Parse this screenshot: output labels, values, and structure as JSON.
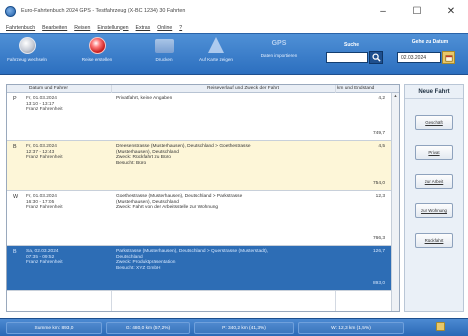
{
  "window": {
    "title": "Euro-Fahrtenbuch 2024 GPS - Testfahrzeug (X-BC 1234) 30 Fahrten",
    "controls": {
      "minimize": "–",
      "maximize": "☐",
      "close": "✕"
    }
  },
  "menu": [
    "Fahrtenbuch",
    "Bearbeiten",
    "Reisen",
    "Einstellungen",
    "Extras",
    "Online",
    "?"
  ],
  "toolbar": {
    "buttons": [
      {
        "label": "Fahrzeug wechseln",
        "icon": "car-icon"
      },
      {
        "label": "Reise erstellen",
        "icon": "stop-icon"
      },
      {
        "label": "Drucken",
        "icon": "print-icon"
      },
      {
        "label": "Auf Karte zeigen",
        "icon": "navigate-icon"
      },
      {
        "label": "Daten importieren",
        "icon": "gps-icon",
        "icon_text": "GPS"
      }
    ],
    "search": {
      "label": "Suche",
      "value": ""
    },
    "goto": {
      "label": "Gehe zu Datum",
      "value": "02.03.2024"
    }
  },
  "grid": {
    "headers": {
      "date": "Datum und Fahrer",
      "route": "Reiseverlauf und Zweck der Fahrt",
      "km": "km und Endstand"
    },
    "rows": [
      {
        "flag": "P",
        "date": "Fr, 01.03.2024\n13:10 - 13:17\nFranz Fahrenheit",
        "route": "Privatfahrt, keine Angaben",
        "km": "4,2",
        "end": "749,7",
        "bg": "#ffffff",
        "selected": false
      },
      {
        "flag": "B",
        "date": "Fr, 01.03.2024\n12:37 - 12:43\nFranz Fahrenheit",
        "route": "Dreesenstrasse (Musterhausen), Deutschland > Goethestrasse\n(Musterhausen), Deutschland\nZweck: Rückfahrt zu Büro\nBesucht: Büro",
        "km": "4,5",
        "end": "754,0",
        "bg": "#fdf6d8",
        "selected": false
      },
      {
        "flag": "W",
        "date": "Fr, 01.03.2024\n16:30 - 17:05\nFranz Fahrenheit",
        "route": "Goethestrasse (Musterhausen), Deutschland > Parkstrasse\n(Musterhausen), Deutschland\nZweck: Fahrt von der Arbeitsstelle zur Wohnung",
        "km": "12,3",
        "end": "766,3",
        "bg": "#ffffff",
        "selected": false
      },
      {
        "flag": "B",
        "date": "Sa, 02.03.2024\n07:35 - 09:52\nFranz Fahrenheit",
        "route": "Parkstrasse (Musterhausen), Deutschland > Querstrasse (Musterstadt),\nDeutschland\nZweck: Produktpräsentation\nBesucht: XYZ GmbH",
        "km": "126,7",
        "end": "893,0",
        "bg": "#2d6db5",
        "selected": true
      }
    ]
  },
  "side": {
    "title": "Neue Fahrt",
    "buttons": [
      "Geschäft",
      "Privat",
      "zur Arbeit",
      "zur Wohnung",
      "Rückfahrt"
    ]
  },
  "status": {
    "items": [
      "Summe km: 893,0",
      "G: 480,0 km (57,2%)",
      "P: 340,2 km (41,3%)",
      "W: 12,3 km (1,5%)"
    ]
  },
  "colors": {
    "accent": "#2c6fbf",
    "selected_row": "#2d6db5",
    "business_row": "#fdf6d8"
  }
}
